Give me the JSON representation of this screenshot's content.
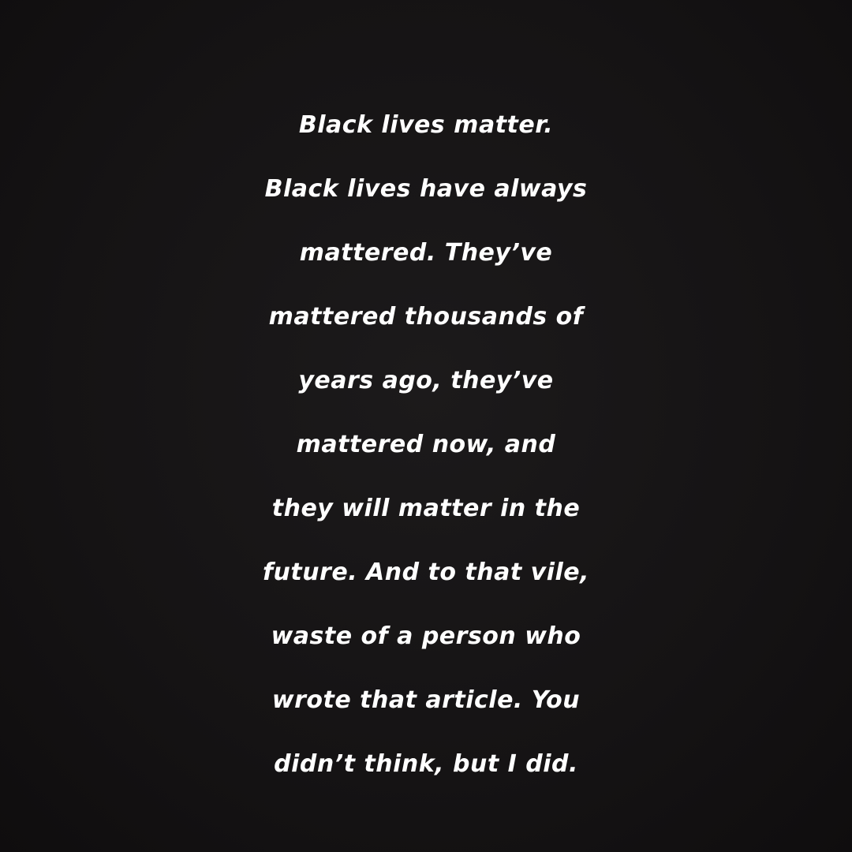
{
  "story": {
    "background_color": "#151314",
    "text_color": "#ffffff",
    "lines": [
      "Black lives matter.",
      "Black lives have always",
      "mattered. They’ve",
      "mattered thousands of",
      "years ago, they’ve",
      "mattered now, and",
      "they will matter in the",
      "future. And to that vile,",
      "waste of a person who",
      "wrote that article. You",
      "didn’t think, but I did."
    ]
  }
}
